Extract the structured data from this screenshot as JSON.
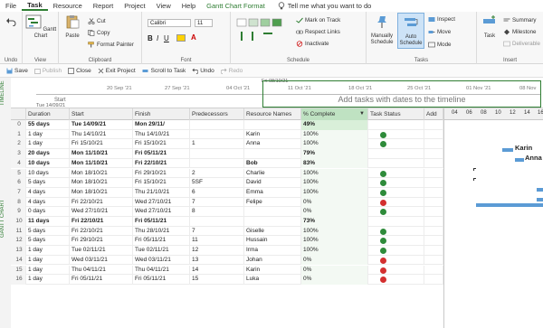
{
  "menu": {
    "items": [
      "File",
      "Task",
      "Resource",
      "Report",
      "Project",
      "View",
      "Help",
      "Gantt Chart Format"
    ],
    "active": "Task",
    "tell_me": "Tell me what you want to do"
  },
  "ribbon": {
    "undo_group": "Undo",
    "view_group": "View",
    "gantt_chart": "Gantt Chart",
    "clipboard_group": "Clipboard",
    "paste": "Paste",
    "cut": "Cut",
    "copy": "Copy",
    "format_painter": "Format Painter",
    "font_group": "Font",
    "font_name": "Calibri",
    "font_size": "11",
    "schedule_group": "Schedule",
    "mark_on_track": "Mark on Track",
    "respect_links": "Respect Links",
    "inactivate": "Inactivate",
    "tasks_group": "Tasks",
    "manually_schedule": "Manually Schedule",
    "auto_schedule": "Auto Schedule",
    "inspect": "Inspect",
    "move": "Move",
    "mode": "Mode",
    "task": "Task",
    "insert_group": "Insert",
    "summary": "Summary",
    "milestone": "Milestone",
    "deliverable": "Deliverable"
  },
  "quickbar": {
    "save": "Save",
    "publish": "Publish",
    "close": "Close",
    "exit_project": "Exit Project",
    "scroll_to_task": "Scroll to Task",
    "undo": "Undo",
    "redo": "Redo"
  },
  "timeline": {
    "side_label": "TIMELINE",
    "start_label": "Start",
    "start_date": "Tue 14/09/21",
    "top_date": "Fri 08/10/21",
    "dates": [
      "20 Sep '21",
      "27 Sep '21",
      "04 Oct '21",
      "11 Oct '21",
      "18 Oct '21",
      "25 Oct '21",
      "01 Nov '21",
      "08 Nov"
    ],
    "hint": "Add tasks with dates to the timeline"
  },
  "grid": {
    "side_label": "GANTT CHART",
    "columns": [
      "Duration",
      "Start",
      "Finish",
      "Predecessors",
      "Resource Names",
      "% Complete",
      "Task Status",
      "Add"
    ],
    "rows": [
      {
        "id": "0",
        "duration": "55 days",
        "start": "Tue 14/09/21",
        "finish": "Mon 29/11/",
        "pred": "",
        "res": "",
        "pct": "49%",
        "status": "",
        "bold": true
      },
      {
        "id": "1",
        "duration": "1 day",
        "start": "Thu 14/10/21",
        "finish": "Thu 14/10/21",
        "pred": "",
        "res": "Karin",
        "pct": "100%",
        "status": "green",
        "bold": false
      },
      {
        "id": "2",
        "duration": "1 day",
        "start": "Fri 15/10/21",
        "finish": "Fri 15/10/21",
        "pred": "1",
        "res": "Anna",
        "pct": "100%",
        "status": "green",
        "bold": false
      },
      {
        "id": "3",
        "duration": "20 days",
        "start": "Mon 11/10/21",
        "finish": "Fri 05/11/21",
        "pred": "",
        "res": "",
        "pct": "79%",
        "status": "",
        "bold": true
      },
      {
        "id": "4",
        "duration": "10 days",
        "start": "Mon 11/10/21",
        "finish": "Fri 22/10/21",
        "pred": "",
        "res": "Bob",
        "pct": "83%",
        "status": "",
        "bold": true
      },
      {
        "id": "5",
        "duration": "10 days",
        "start": "Mon 18/10/21",
        "finish": "Fri 29/10/21",
        "pred": "2",
        "res": "Charlie",
        "pct": "100%",
        "status": "green",
        "bold": false
      },
      {
        "id": "6",
        "duration": "5 days",
        "start": "Mon 18/10/21",
        "finish": "Fri 15/10/21",
        "pred": "5SF",
        "res": "David",
        "pct": "100%",
        "status": "green",
        "bold": false
      },
      {
        "id": "7",
        "duration": "4 days",
        "start": "Mon 18/10/21",
        "finish": "Thu 21/10/21",
        "pred": "6",
        "res": "Emma",
        "pct": "100%",
        "status": "green",
        "bold": false
      },
      {
        "id": "8",
        "duration": "4 days",
        "start": "Fri 22/10/21",
        "finish": "Wed 27/10/21",
        "pred": "7",
        "res": "Felipe",
        "pct": "0%",
        "status": "red",
        "bold": false
      },
      {
        "id": "9",
        "duration": "0 days",
        "start": "Wed 27/10/21",
        "finish": "Wed 27/10/21",
        "pred": "8",
        "res": "",
        "pct": "0%",
        "status": "green",
        "bold": false
      },
      {
        "id": "10",
        "duration": "11 days",
        "start": "Fri 22/10/21",
        "finish": "Fri 05/11/21",
        "pred": "",
        "res": "",
        "pct": "73%",
        "status": "",
        "bold": true
      },
      {
        "id": "11",
        "duration": "5 days",
        "start": "Fri 22/10/21",
        "finish": "Thu 28/10/21",
        "pred": "7",
        "res": "Giselle",
        "pct": "100%",
        "status": "green",
        "bold": false
      },
      {
        "id": "12",
        "duration": "5 days",
        "start": "Fri 29/10/21",
        "finish": "Fri 05/11/21",
        "pred": "11",
        "res": "Hussain",
        "pct": "100%",
        "status": "green",
        "bold": false
      },
      {
        "id": "13",
        "duration": "1 day",
        "start": "Tue 02/11/21",
        "finish": "Tue 02/11/21",
        "pred": "12",
        "res": "Irma",
        "pct": "100%",
        "status": "green",
        "bold": false
      },
      {
        "id": "14",
        "duration": "1 day",
        "start": "Wed 03/11/21",
        "finish": "Wed 03/11/21",
        "pred": "13",
        "res": "Johan",
        "pct": "0%",
        "status": "red",
        "bold": false
      },
      {
        "id": "15",
        "duration": "1 day",
        "start": "Thu 04/11/21",
        "finish": "Thu 04/11/21",
        "pred": "14",
        "res": "Karin",
        "pct": "0%",
        "status": "red",
        "bold": false
      },
      {
        "id": "16",
        "duration": "1 day",
        "start": "Fri 05/11/21",
        "finish": "Fri 05/11/21",
        "pred": "15",
        "res": "Luka",
        "pct": "0%",
        "status": "red",
        "bold": false
      }
    ]
  },
  "gantt": {
    "header": [
      "04",
      "06",
      "08",
      "10",
      "12",
      "14",
      "16"
    ],
    "labels": [
      "Karin",
      "Anna"
    ]
  },
  "colors": {
    "accent": "#2e7d32",
    "bar": "#5b9bd5",
    "green": "#2e8b3a",
    "red": "#d32f2f"
  }
}
